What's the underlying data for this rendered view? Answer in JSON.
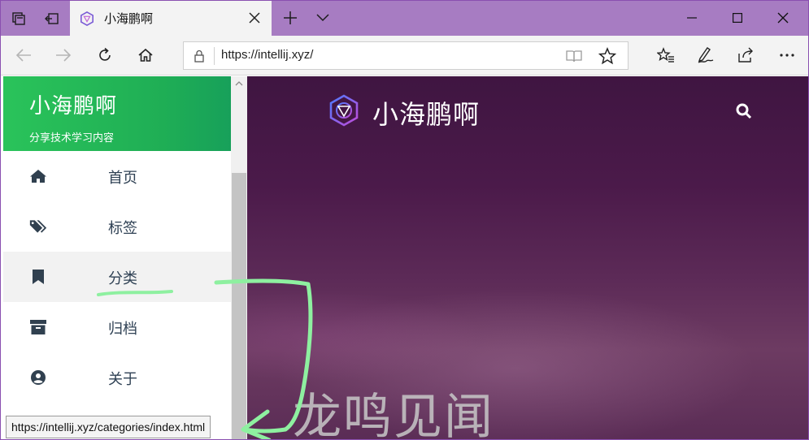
{
  "tab": {
    "title": "小海鹏啊"
  },
  "address_bar": {
    "url": "https://intellij.xyz/"
  },
  "sidebar": {
    "brand_title": "小海鹏啊",
    "brand_subtitle": "分享技术学习内容",
    "items": [
      {
        "label": "首页",
        "icon": "home-icon"
      },
      {
        "label": "标签",
        "icon": "tags-icon"
      },
      {
        "label": "分类",
        "icon": "bookmark-icon",
        "active": true
      },
      {
        "label": "归档",
        "icon": "archive-icon"
      },
      {
        "label": "关于",
        "icon": "user-circle-icon"
      }
    ]
  },
  "main": {
    "site_title": "小海鹏啊",
    "watermark": "龙鸣见闻"
  },
  "status_bar": {
    "url": "https://intellij.xyz/categories/index.html"
  },
  "colors": {
    "titlebar": "#a77cc2",
    "sidebar_brand": "#1fae55",
    "main_bg": "#4b1a4a",
    "annotation": "#8ef0a0"
  }
}
